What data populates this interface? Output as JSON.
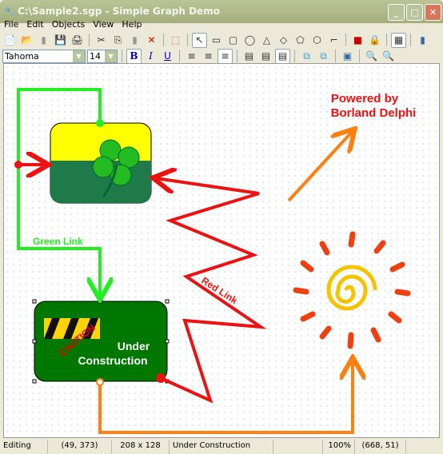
{
  "window": {
    "title": "C:\\Sample2.sgp - Simple Graph Demo",
    "app_icon": "graph-app-icon",
    "minimize": "_",
    "maximize": "□",
    "close": "✕"
  },
  "menu": [
    "File",
    "Edit",
    "Objects",
    "View",
    "Help"
  ],
  "format": {
    "font": "Tahoma",
    "size": "14"
  },
  "diagram": {
    "powered_text_1": "Powered by",
    "powered_text_2": "Borland Delphi",
    "node_construction": {
      "line1": "Under",
      "line2": "Construction",
      "caution": "CAUTION"
    },
    "green_link": "Green Link",
    "red_link": "Red Link",
    "colors": {
      "green": "#22ee22",
      "red": "#ee1111",
      "orange": "#ff7f10",
      "node_green": "#007700",
      "yellow": "#ffff00"
    }
  },
  "status": {
    "mode": "Editing",
    "position": "(49, 373)",
    "size": "208 x 128",
    "selected": "Under Construction",
    "blank": "",
    "zoom": "100%",
    "cursor": "(668, 51)"
  }
}
